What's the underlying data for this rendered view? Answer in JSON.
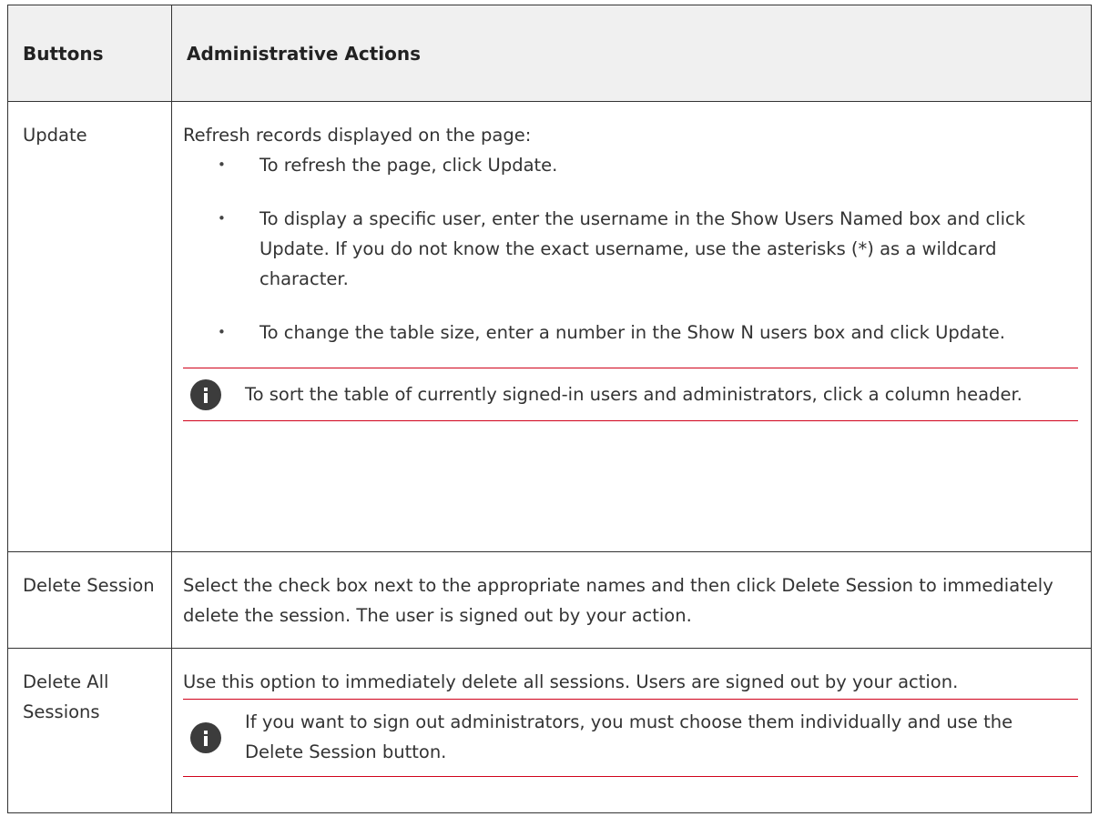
{
  "table": {
    "headers": [
      "Buttons",
      "Administrative Actions"
    ],
    "rows": [
      {
        "button": "Update",
        "intro": "Refresh records displayed on the page:",
        "bullets": [
          "To refresh the page, click Update.",
          "To display a specific user, enter the username in the Show Users Named box and click Update. If you do not know the exact username, use the asterisks (*) as a wildcard character.",
          "To change the table size, enter a number in the Show N users box and click Update."
        ],
        "note": "To sort the table of currently signed-in users and administrators, click a column header."
      },
      {
        "button": "Delete Session",
        "intro": "Select the check box next to the appropriate names and then click Delete Session to immediately delete the session. The user is signed out by your action."
      },
      {
        "button": "Delete All Sessions",
        "intro": "Use this option to immediately delete all sessions. Users are signed out by your action.",
        "note": "If you want to sign out administrators, you must choose them individually and use the Delete Session button."
      }
    ]
  },
  "icons": {
    "note": "info-icon"
  },
  "colors": {
    "note_rule": "#d0021b",
    "header_bg": "#f0f0f0",
    "icon_bg": "#3c3c3c"
  }
}
